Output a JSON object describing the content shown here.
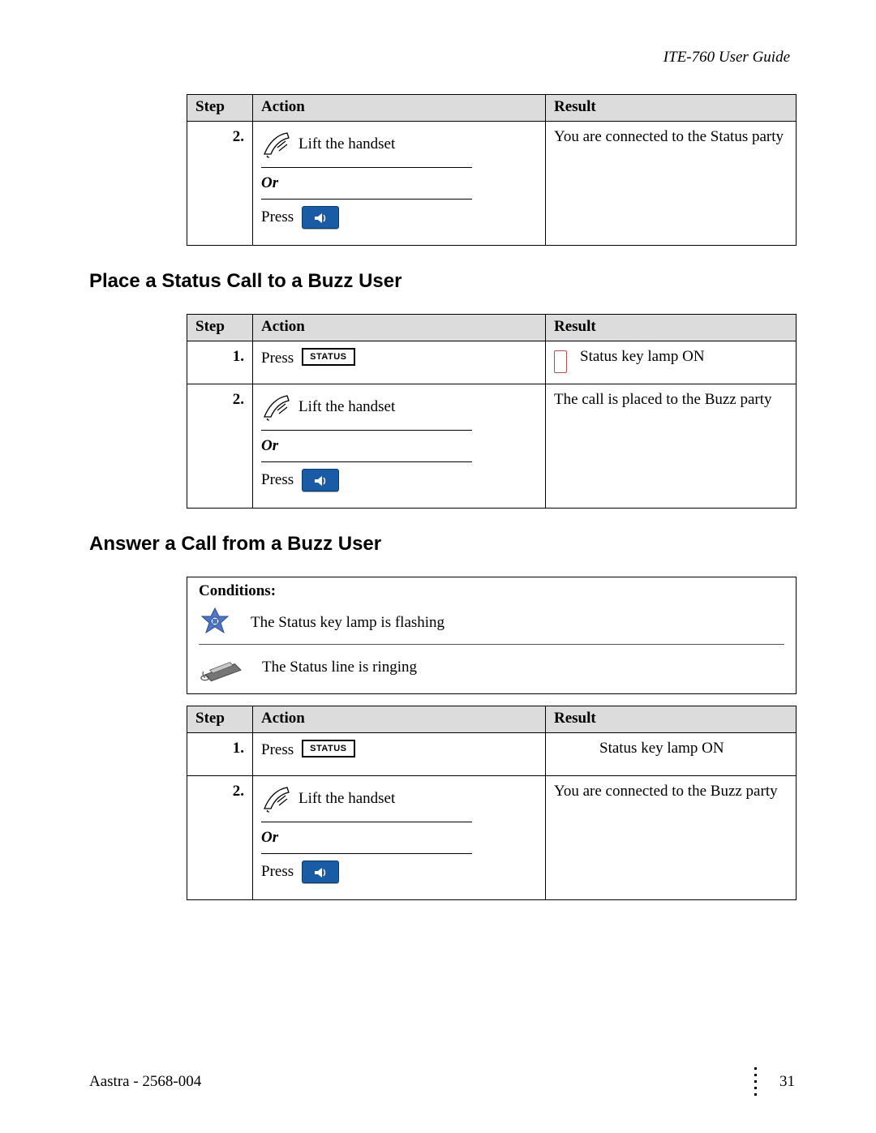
{
  "header": {
    "title": "ITE-760 User Guide"
  },
  "labels": {
    "step": "Step",
    "action": "Action",
    "result": "Result",
    "or": "Or",
    "press": "Press",
    "lift_handset": "Lift the handset",
    "status_btn": "STATUS",
    "conditions": "Conditions:"
  },
  "sections": {
    "place_buzz": "Place a Status Call to a Buzz User",
    "answer_buzz": "Answer a Call from a Buzz User"
  },
  "table1": {
    "rows": [
      {
        "step": "2.",
        "result": "You are connected to the Status party"
      }
    ]
  },
  "table2": {
    "rows": [
      {
        "step": "1.",
        "result": "Status key lamp ON"
      },
      {
        "step": "2.",
        "result": "The call is placed to the Buzz party"
      }
    ]
  },
  "conditions": {
    "c1": "The Status key lamp is flashing",
    "c2": "The Status line is ringing"
  },
  "table3": {
    "rows": [
      {
        "step": "1.",
        "result": "Status key lamp ON"
      },
      {
        "step": "2.",
        "result": "You are connected to the Buzz party"
      }
    ]
  },
  "footer": {
    "left": "Aastra - 2568-004",
    "page": "31"
  }
}
